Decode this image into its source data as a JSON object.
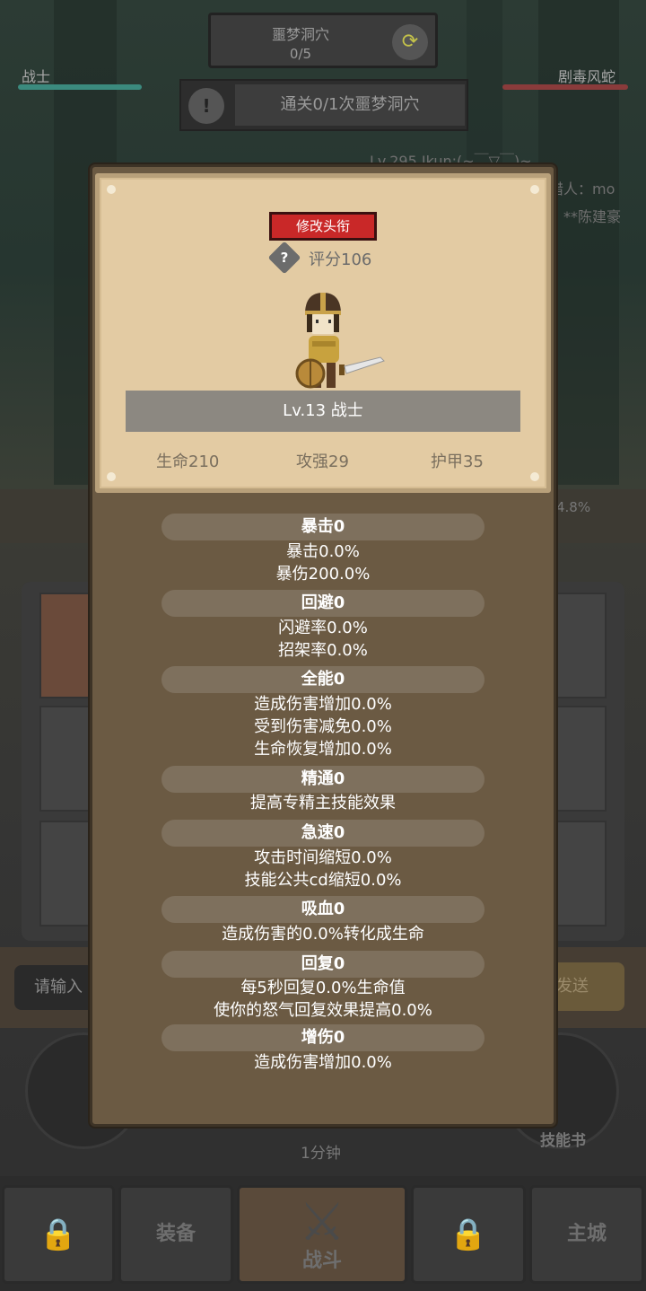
{
  "hud": {
    "dungeon_name": "噩梦洞穴",
    "dungeon_progress": "0/5",
    "player_name": "战士",
    "enemy_name": "剧毒风蛇",
    "quest_text": "通关0/1次噩梦洞穴",
    "progress_percent": "4.8%"
  },
  "chat": {
    "lines": [
      "Lv.295 Ikun:(~￣▽￣)~",
      "猎人：mo",
      "**陈建豪"
    ],
    "input_placeholder": "请输入",
    "send_label": "发送"
  },
  "skills": {
    "timer_label": "1分钟",
    "skill_book_label": "技能书"
  },
  "nav": {
    "equip_label": "装备",
    "battle_label": "战斗",
    "city_label": "主城"
  },
  "profile": {
    "title_button": "修改头衔",
    "score": "评分106",
    "level_class": "Lv.13 战士",
    "hp": "生命210",
    "attack": "攻强29",
    "armor": "护甲35"
  },
  "attributes": [
    {
      "header": "暴击0",
      "lines": [
        "暴击0.0%",
        "暴伤200.0%"
      ]
    },
    {
      "header": "回避0",
      "lines": [
        "闪避率0.0%",
        "招架率0.0%"
      ]
    },
    {
      "header": "全能0",
      "lines": [
        "造成伤害增加0.0%",
        "受到伤害减免0.0%",
        "生命恢复增加0.0%"
      ]
    },
    {
      "header": "精通0",
      "lines": [
        "提高专精主技能效果"
      ]
    },
    {
      "header": "急速0",
      "lines": [
        "攻击时间缩短0.0%",
        "技能公共cd缩短0.0%"
      ]
    },
    {
      "header": "吸血0",
      "lines": [
        "造成伤害的0.0%转化成生命"
      ]
    },
    {
      "header": "回复0",
      "lines": [
        "每5秒回复0.0%生命值",
        "使你的怒气回复效果提高0.0%"
      ]
    },
    {
      "header": "增伤0",
      "lines": [
        "造成伤害增加0.0%"
      ]
    }
  ]
}
